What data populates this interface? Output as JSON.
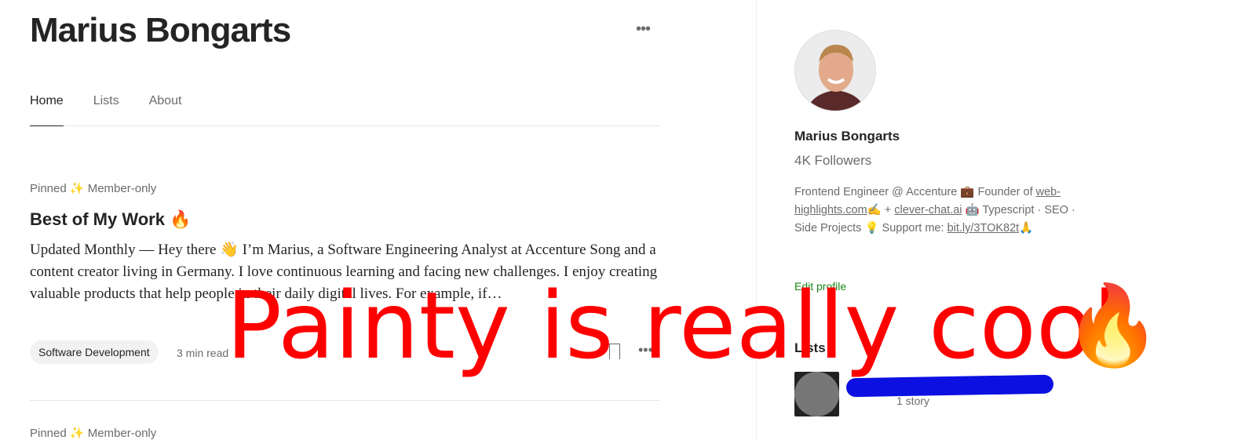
{
  "header": {
    "title": "Marius Bongarts",
    "more_icon": "ellipsis-icon"
  },
  "tabs": [
    {
      "label": "Home",
      "active": true
    },
    {
      "label": "Lists"
    },
    {
      "label": "About"
    }
  ],
  "posts": [
    {
      "meta": "Pinned ✨ Member-only",
      "title": "Best of My Work 🔥",
      "excerpt": "Updated Monthly — Hey there 👋 I’m Marius, a Software Engineering Analyst at Accenture Song and a content creator living in Germany. I love continuous learning and facing new challenges. I enjoy creating valuable products that help people in their daily digital lives. For example, if…",
      "tag": "Software Development",
      "read_time": "3 min read"
    },
    {
      "meta": "Pinned ✨ Member-only"
    }
  ],
  "sidebar": {
    "name": "Marius Bongarts",
    "followers": "4K Followers",
    "bio_1": "Frontend Engineer @ Accenture 💼 Founder of ",
    "link_1": "web-highlights.com",
    "bio_2": "✍️ + ",
    "link_2": "clever-chat.ai",
    "bio_3": " 🤖 Typescript · SEO · Side Projects 💡 Support me: ",
    "link_3": "bit.ly/3TOK82t",
    "bio_4": "🙏",
    "edit_profile": "Edit profile",
    "lists_title": "Lists",
    "list_count": "1 story"
  },
  "overlay": {
    "text": "Painty is really cool",
    "emoji": "🔥",
    "text_color": "#ff0000",
    "scribble_color": "#0c10e0"
  }
}
